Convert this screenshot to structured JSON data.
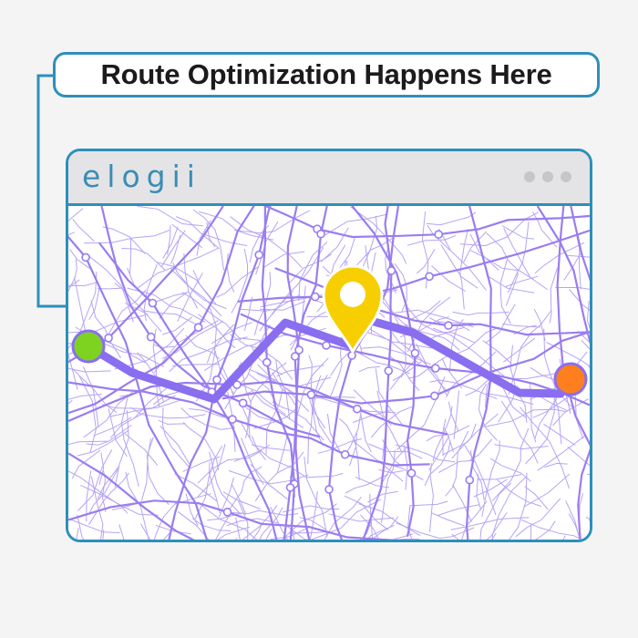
{
  "headline": "Route Optimization Happens Here",
  "app": {
    "brand": "elogii",
    "window_controls": [
      "control-dot",
      "control-dot",
      "control-dot"
    ]
  },
  "map": {
    "street_color": "#9a7df0",
    "background_color": "#ffffff",
    "route_color": "#8a6ef0",
    "start_marker_color": "#7ed320",
    "end_marker_color": "#ff7f1e",
    "destination_pin_color": "#f7cf00",
    "icons": [
      "start-point-icon",
      "map-pin-icon",
      "end-point-icon"
    ]
  },
  "colors": {
    "accent": "#2e8fba",
    "text": "#1b1b1b"
  }
}
